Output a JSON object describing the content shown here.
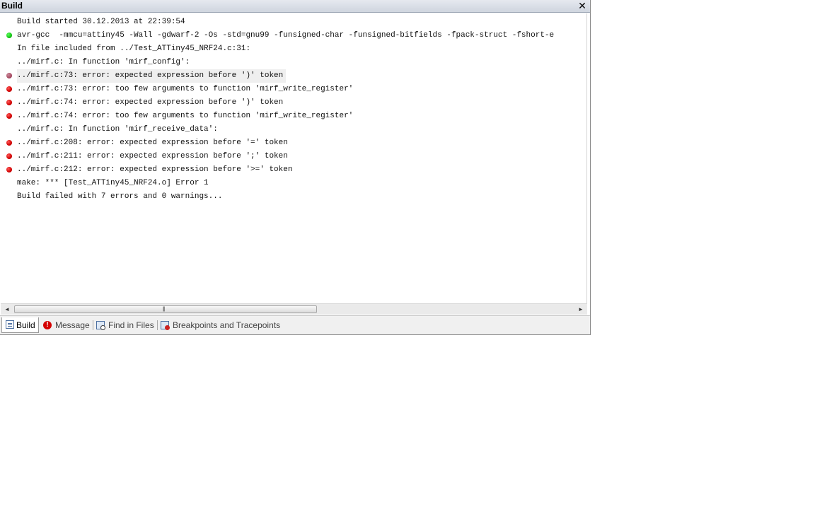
{
  "window": {
    "title": "Build",
    "close_glyph": "✕"
  },
  "output": {
    "lines": [
      {
        "text": "Build started 30.12.2013 at 22:39:54",
        "marker": "none"
      },
      {
        "text": "avr-gcc  -mmcu=attiny45 -Wall -gdwarf-2 -Os -std=gnu99 -funsigned-char -funsigned-bitfields -fpack-struct -fshort-e",
        "marker": "green"
      },
      {
        "text": "In file included from ../Test_ATTiny45_NRF24.c:31:",
        "marker": "none"
      },
      {
        "text": "../mirf.c: In function 'mirf_config':",
        "marker": "none"
      },
      {
        "text": "../mirf.c:73: error: expected expression before ')' token",
        "marker": "red",
        "selected": true
      },
      {
        "text": "../mirf.c:73: error: too few arguments to function 'mirf_write_register'",
        "marker": "red"
      },
      {
        "text": "../mirf.c:74: error: expected expression before ')' token",
        "marker": "red"
      },
      {
        "text": "../mirf.c:74: error: too few arguments to function 'mirf_write_register'",
        "marker": "red"
      },
      {
        "text": "../mirf.c: In function 'mirf_receive_data':",
        "marker": "none"
      },
      {
        "text": "../mirf.c:208: error: expected expression before '=' token",
        "marker": "red"
      },
      {
        "text": "../mirf.c:211: error: expected expression before ';' token",
        "marker": "red"
      },
      {
        "text": "../mirf.c:212: error: expected expression before '>=' token",
        "marker": "red"
      },
      {
        "text": "make: *** [Test_ATTiny45_NRF24.o] Error 1",
        "marker": "none"
      },
      {
        "text": "Build failed with 7 errors and 0 warnings...",
        "marker": "none"
      }
    ],
    "colors": {
      "error_marker": "#d10000",
      "success_marker": "#12c312"
    }
  },
  "scrollbar": {
    "left_arrow": "◄",
    "right_arrow": "►",
    "grip": "|||"
  },
  "tabs": [
    {
      "label": "Build",
      "icon": "document-icon",
      "active": true
    },
    {
      "label": "Message",
      "icon": "error-icon",
      "active": false
    },
    {
      "label": "Find in Files",
      "icon": "find-in-files-icon",
      "active": false
    },
    {
      "label": "Breakpoints and Tracepoints",
      "icon": "breakpoints-icon",
      "active": false
    }
  ]
}
